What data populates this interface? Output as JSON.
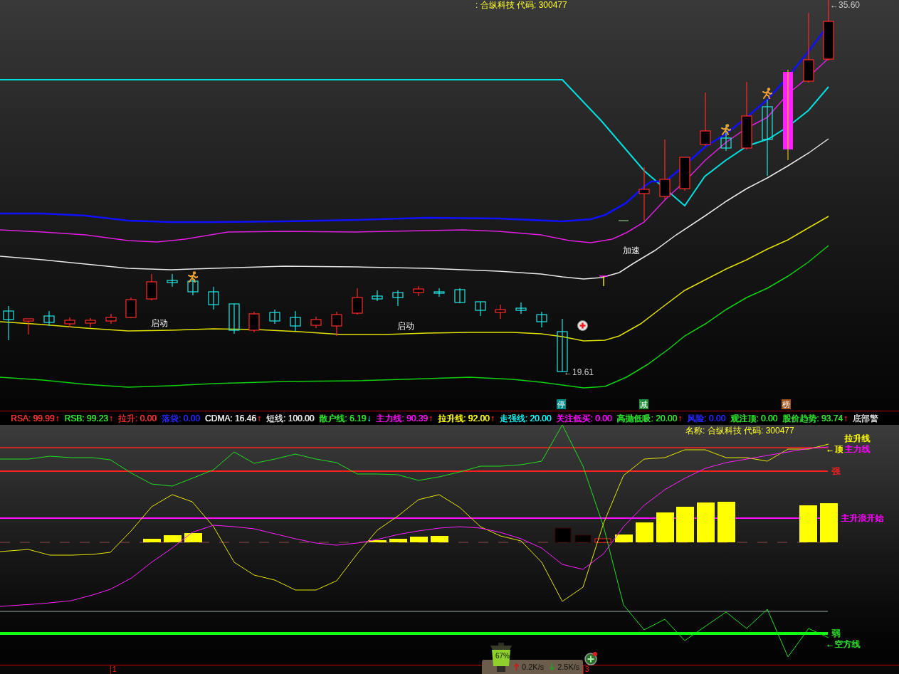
{
  "top_chart": {
    "title": ": 合纵科技 代码: 300477",
    "high_price": "←35.60",
    "low_price": "←19.61",
    "signals": [
      {
        "text": "启动"
      },
      {
        "text": "启动"
      },
      {
        "text": "加速"
      }
    ],
    "markers": [
      {
        "text": "停",
        "color": "#008b8b"
      },
      {
        "text": "减",
        "color": "#1f8f3a"
      },
      {
        "text": "榜",
        "color": "#a0561e"
      }
    ]
  },
  "indicators": [
    {
      "label": "RSA: 99.99",
      "color": "#ff3030",
      "arrow": {
        "text": "↑",
        "kind": "up"
      }
    },
    {
      "label": "RSB: 99.23",
      "color": "#2ee62e",
      "arrow": {
        "text": "↑",
        "kind": "up"
      }
    },
    {
      "label": "拉升: 0.00",
      "color": "#ff3030"
    },
    {
      "label": "落袋: 0.00",
      "color": "#2828ff"
    },
    {
      "label": "CDMA: 16.46",
      "color": "#e8e8e8",
      "arrow": {
        "text": "↑",
        "kind": "up"
      }
    },
    {
      "label": "短线: 100.00",
      "color": "#e8e8e8"
    },
    {
      "label": "散户线: 6.19",
      "color": "#2ee62e",
      "arrow": {
        "text": "↓",
        "kind": "down"
      }
    },
    {
      "label": "主力线: 90.39",
      "color": "#ff00ff",
      "arrow": {
        "text": "↑",
        "kind": "up"
      }
    },
    {
      "label": "拉升线: 92.00",
      "color": "#ffff00",
      "arrow": {
        "text": "↑",
        "kind": "up"
      }
    },
    {
      "label": "走强线: 20.00",
      "color": "#00ffff"
    },
    {
      "label": "关注低买: 0.00",
      "color": "#ff00ff"
    },
    {
      "label": "高抛低吸: 20.00",
      "color": "#2ee62e",
      "arrow": {
        "text": "↑",
        "kind": "up"
      }
    },
    {
      "label": "风险: 0.00",
      "color": "#2828ff"
    },
    {
      "label": "观注顶: 0.00",
      "color": "#2ee62e"
    },
    {
      "label": "股价趋势: 93.74",
      "color": "#2ee62e",
      "arrow": {
        "text": "↑",
        "kind": "up"
      }
    },
    {
      "label": "底部警",
      "color": "#e0e0e0"
    }
  ],
  "bottom_chart": {
    "title": "名称: 合纵科技 代码: 300477",
    "labels": [
      {
        "text": "拉升线",
        "color": "#ffff00"
      },
      {
        "text": "←顶",
        "color": "#ffff00"
      },
      {
        "text": "主力线",
        "color": "#ff00ff"
      },
      {
        "text": "强",
        "color": "#ff2020"
      },
      {
        "text": "主升浪开始",
        "color": "#ff00ff"
      },
      {
        "text": "弱",
        "color": "#2ee62e"
      },
      {
        "text": "←空方线",
        "color": "#2ee62e"
      }
    ]
  },
  "axis_labels": [
    "1",
    "3"
  ],
  "status": {
    "lamp": "67%",
    "upload": "0.2K/s",
    "download": "2.5K/s"
  }
}
